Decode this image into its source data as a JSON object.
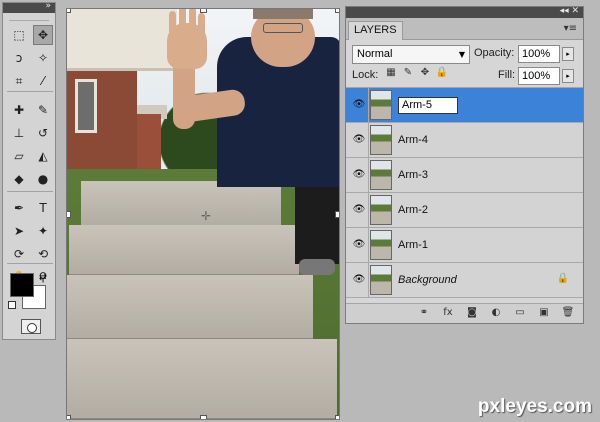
{
  "tools": {
    "collapse_glyph": "»",
    "items": [
      {
        "name": "marquee-tool-icon",
        "glyph": "⬚"
      },
      {
        "name": "move-tool-icon",
        "glyph": "✥"
      },
      {
        "name": "lasso-tool-icon",
        "glyph": "ↄ"
      },
      {
        "name": "magic-wand-tool-icon",
        "glyph": "✧"
      },
      {
        "name": "crop-tool-icon",
        "glyph": "⌗"
      },
      {
        "name": "eyedropper-tool-icon",
        "glyph": "⁄"
      },
      {
        "name": "healing-brush-tool-icon",
        "glyph": "✚"
      },
      {
        "name": "brush-tool-icon",
        "glyph": "✎"
      },
      {
        "name": "clone-stamp-tool-icon",
        "glyph": "⊥"
      },
      {
        "name": "history-brush-tool-icon",
        "glyph": "↺"
      },
      {
        "name": "eraser-tool-icon",
        "glyph": "▱"
      },
      {
        "name": "paint-bucket-tool-icon",
        "glyph": "◭"
      },
      {
        "name": "blur-tool-icon",
        "glyph": "◆"
      },
      {
        "name": "dodge-tool-icon",
        "glyph": "●"
      },
      {
        "name": "pen-tool-icon",
        "glyph": "✒"
      },
      {
        "name": "type-tool-icon",
        "glyph": "T"
      },
      {
        "name": "path-selection-tool-icon",
        "glyph": "➤"
      },
      {
        "name": "shape-tool-icon",
        "glyph": "✦"
      },
      {
        "name": "3d-rotate-tool-icon",
        "glyph": "⟳"
      },
      {
        "name": "3d-orbit-tool-icon",
        "glyph": "⟲"
      },
      {
        "name": "hand-tool-icon",
        "glyph": "✋"
      },
      {
        "name": "zoom-tool-icon",
        "glyph": "⚲"
      }
    ],
    "swap_glyph": "⇄"
  },
  "layers_panel": {
    "header_controls": "◂◂ ✕",
    "tab_label": "LAYERS",
    "menu_glyph": "▾≡",
    "blend_mode": "Normal",
    "opacity_label": "Opacity:",
    "opacity_value": "100%",
    "lock_label": "Lock:",
    "fill_label": "Fill:",
    "fill_value": "100%",
    "lock_icons": [
      "▦",
      "✎",
      "✥",
      "🔒"
    ],
    "layers": [
      {
        "name": "Arm-5",
        "selected": true,
        "editing": true,
        "italic": false,
        "locked": false
      },
      {
        "name": "Arm-4",
        "selected": false,
        "editing": false,
        "italic": false,
        "locked": false
      },
      {
        "name": "Arm-3",
        "selected": false,
        "editing": false,
        "italic": false,
        "locked": false
      },
      {
        "name": "Arm-2",
        "selected": false,
        "editing": false,
        "italic": false,
        "locked": false
      },
      {
        "name": "Arm-1",
        "selected": false,
        "editing": false,
        "italic": false,
        "locked": false
      },
      {
        "name": "Background",
        "selected": false,
        "editing": false,
        "italic": true,
        "locked": true
      }
    ],
    "bottom_icons": [
      {
        "name": "link-layers-icon",
        "glyph": "⚭"
      },
      {
        "name": "layer-style-icon",
        "glyph": "fx"
      },
      {
        "name": "add-mask-icon",
        "glyph": "◙"
      },
      {
        "name": "adjustment-layer-icon",
        "glyph": "◐"
      },
      {
        "name": "new-group-icon",
        "glyph": "▭"
      },
      {
        "name": "new-layer-icon",
        "glyph": "▣"
      },
      {
        "name": "delete-layer-icon",
        "glyph": "🗑"
      }
    ]
  },
  "colors": {
    "selection": "#3c82d8",
    "panel": "#d6d6d6",
    "panel_header": "#4a4a4a"
  },
  "watermark": "pxleyes.com"
}
